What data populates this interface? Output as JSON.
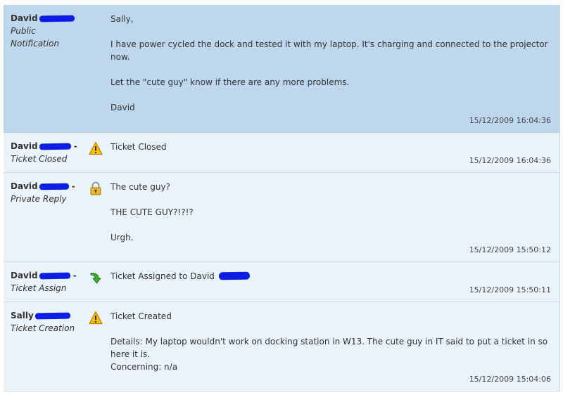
{
  "entries": [
    {
      "author": "David",
      "type_lines": [
        "Public",
        "Notification"
      ],
      "icon": "none",
      "content": [
        "Sally,",
        "I have power cycled the dock and tested it with my laptop. It's charging and connected to the projector now.",
        "Let the \"cute guy\" know if there are any more problems.",
        "David"
      ],
      "timestamp": "15/12/2009 16:04:36"
    },
    {
      "author": "David",
      "type": "Ticket Closed",
      "icon": "warning-icon",
      "content": [
        "Ticket Closed"
      ],
      "timestamp": "15/12/2009 16:04:36"
    },
    {
      "author": "David",
      "type": "Private Reply",
      "icon": "lock-icon",
      "content": [
        "The cute guy?",
        "THE CUTE GUY?!?!?",
        "Urgh."
      ],
      "timestamp": "15/12/2009 15:50:12"
    },
    {
      "author": "David",
      "type": "Ticket Assign",
      "icon": "assign-arrow-icon",
      "content": [
        "Ticket Assigned to David"
      ],
      "timestamp": "15/12/2009 15:50:11"
    },
    {
      "author": "Sally",
      "type": "Ticket Creation",
      "icon": "warning-icon",
      "content": [
        "Ticket Created",
        "Details: My laptop wouldn't work on docking station in W13. The cute guy in IT said to put a ticket in so here it is.",
        "Concerning: n/a"
      ],
      "timestamp": "15/12/2009 15:04:06"
    }
  ],
  "colors": {
    "public_bg": "#bcd7ee",
    "entry_bg": "#eaf3fa",
    "redaction": "#0a1ee6"
  }
}
